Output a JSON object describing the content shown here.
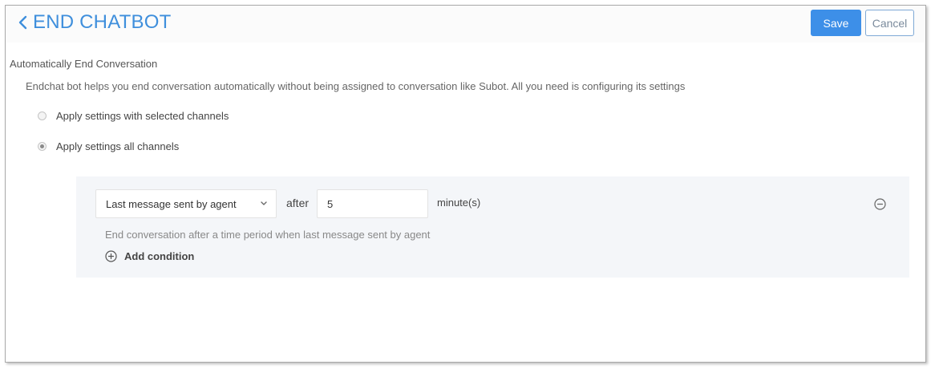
{
  "header": {
    "title": "END CHATBOT",
    "back_icon": "chevron-left-icon",
    "save_label": "Save",
    "cancel_label": "Cancel"
  },
  "section": {
    "title": "Automatically End Conversation",
    "description": "Endchat bot helps you end conversation automatically without being assigned to conversation like Subot. All you need is configuring its settings"
  },
  "scope_options": [
    {
      "label": "Apply settings with selected channels",
      "selected": false
    },
    {
      "label": "Apply settings all channels",
      "selected": true
    }
  ],
  "condition": {
    "trigger_selected": "Last message sent by agent",
    "after_label": "after",
    "minutes_value": "5",
    "unit_label": "minute(s)",
    "hint": "End conversation after a time period when last message sent by agent",
    "remove_icon": "minus-circle-icon"
  },
  "add_condition": {
    "label": "Add condition",
    "icon": "plus-circle-icon"
  },
  "colors": {
    "accent": "#3d8fe8",
    "title": "#3f8fdc",
    "panel_bg": "#f4f6f9"
  }
}
